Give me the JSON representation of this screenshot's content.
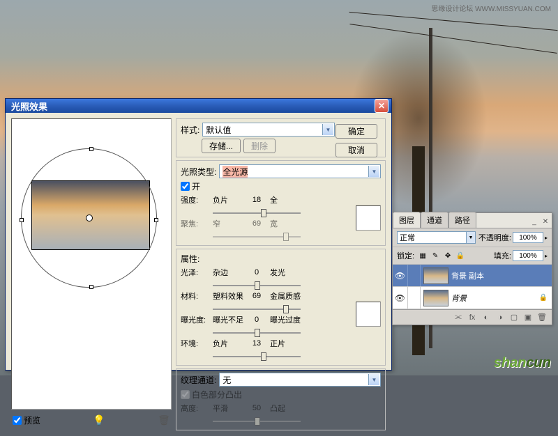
{
  "credit_text": "思缘设计论坛  WWW.MISSYUAN.COM",
  "dialog": {
    "title": "光照效果",
    "ok": "确定",
    "cancel": "取消",
    "style_label": "样式:",
    "style_value": "默认值",
    "save_btn": "存储...",
    "delete_btn": "删除",
    "light_type_label": "光照类型:",
    "light_type_value": "全光源",
    "on_label": "开",
    "intensity_label": "强度:",
    "intensity_left": "负片",
    "intensity_val": "18",
    "intensity_right": "全",
    "focus_label": "聚焦:",
    "focus_left": "窄",
    "focus_val": "69",
    "focus_right": "宽",
    "props_label": "属性:",
    "gloss_label": "光泽:",
    "gloss_left": "杂边",
    "gloss_val": "0",
    "gloss_right": "发光",
    "material_label": "材料:",
    "material_left": "塑料效果",
    "material_val": "69",
    "material_right": "金属质感",
    "exposure_label": "曝光度:",
    "exposure_left": "曝光不足",
    "exposure_val": "0",
    "exposure_right": "曝光过度",
    "ambience_label": "环境:",
    "ambience_left": "负片",
    "ambience_val": "13",
    "ambience_right": "正片",
    "texture_label": "纹理通道:",
    "texture_value": "无",
    "white_high_label": "白色部分凸出",
    "height_label": "高度:",
    "height_left": "平滑",
    "height_val": "50",
    "height_right": "凸起",
    "preview_label": "预览"
  },
  "layers": {
    "tab_layers": "图层",
    "tab_channels": "通道",
    "tab_paths": "路径",
    "blend_mode": "正常",
    "opacity_label": "不透明度:",
    "opacity_value": "100%",
    "lock_label": "锁定:",
    "fill_label": "填充:",
    "fill_value": "100%",
    "layer1": "背景 副本",
    "layer2": "背景"
  },
  "watermark": {
    "a": "shan",
    "b": "cun"
  }
}
